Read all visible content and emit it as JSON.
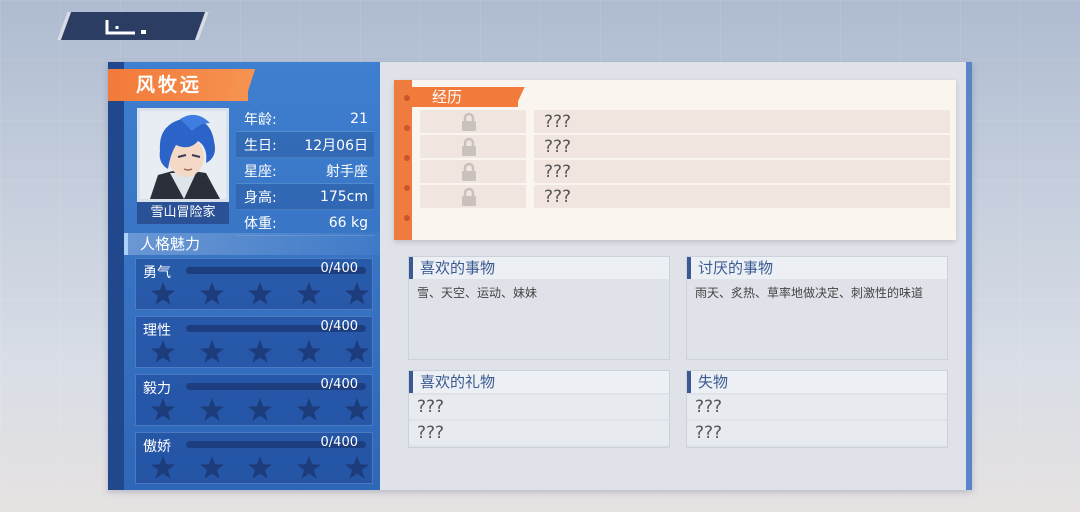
{
  "character": {
    "name": "风牧远",
    "title": "雪山冒险家",
    "info": [
      {
        "label": "年龄:",
        "value": "21"
      },
      {
        "label": "生日:",
        "value": "12月06日"
      },
      {
        "label": "星座:",
        "value": "射手座"
      },
      {
        "label": "身高:",
        "value": "175cm"
      },
      {
        "label": "体重:",
        "value": "66 kg"
      }
    ]
  },
  "charm": {
    "header": "人格魅力",
    "stats": [
      {
        "name": "勇气",
        "value": "0/400",
        "stars_filled": 0,
        "stars_total": 5
      },
      {
        "name": "理性",
        "value": "0/400",
        "stars_filled": 0,
        "stars_total": 5
      },
      {
        "name": "毅力",
        "value": "0/400",
        "stars_filled": 0,
        "stars_total": 5
      },
      {
        "name": "傲娇",
        "value": "0/400",
        "stars_filled": 0,
        "stars_total": 5
      }
    ]
  },
  "experience": {
    "header": "经历",
    "rows": [
      "???",
      "???",
      "???",
      "???"
    ]
  },
  "likes": {
    "header": "喜欢的事物",
    "text": "雪、天空、运动、妹妹"
  },
  "dislikes": {
    "header": "讨厌的事物",
    "text": "雨天、炙热、草率地做决定、刺激性的味道"
  },
  "gifts": {
    "header": "喜欢的礼物",
    "rows": [
      "???",
      "???"
    ]
  },
  "lost_items": {
    "header": "失物",
    "rows": [
      "???",
      "???"
    ]
  },
  "colors": {
    "accent": "#f27a3a",
    "panel_blue": "#3f7fcf",
    "dark_navy": "#2b3d63"
  },
  "icons": {
    "back": "back-arrow-icon",
    "lock": "lock-icon",
    "star": "star-icon"
  }
}
